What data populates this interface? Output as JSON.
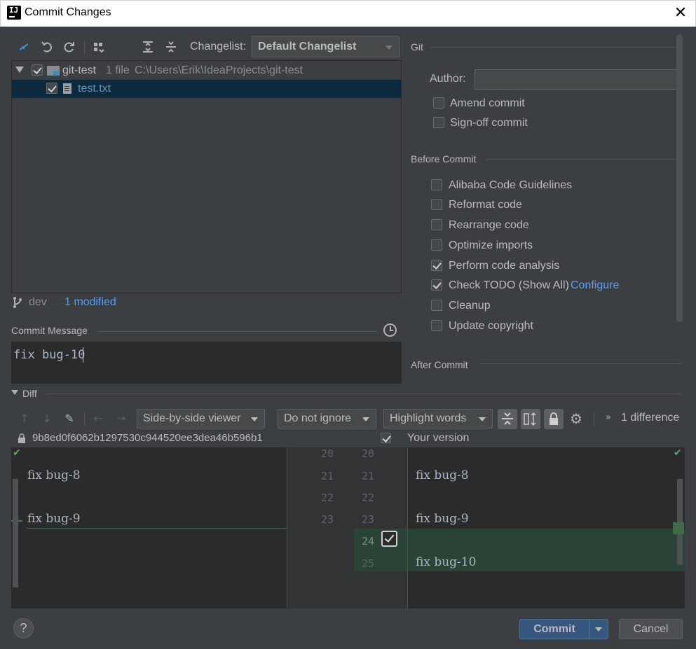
{
  "window": {
    "title": "Commit Changes",
    "close_glyph": "✕"
  },
  "toolbar": {
    "changelist_label": "Changelist:",
    "changelist_value": "Default Changelist"
  },
  "tree": {
    "root": {
      "name": "git-test",
      "count": "1 file",
      "path": "C:\\Users\\Erik\\IdeaProjects\\git-test"
    },
    "file": {
      "name": "test.txt"
    }
  },
  "status": {
    "branch": "dev",
    "modified": "1 modified"
  },
  "commit_message": {
    "label": "Commit Message",
    "value": "fix bug-10"
  },
  "git": {
    "section": "Git",
    "author_label": "Author:",
    "author_value": "",
    "amend": "Amend commit",
    "signoff": "Sign-off commit"
  },
  "before_commit": {
    "section": "Before Commit",
    "items": [
      {
        "label": "Alibaba Code Guidelines",
        "checked": false
      },
      {
        "label": "Reformat code",
        "checked": false
      },
      {
        "label": "Rearrange code",
        "checked": false
      },
      {
        "label": "Optimize imports",
        "checked": false
      },
      {
        "label": "Perform code analysis",
        "checked": true
      },
      {
        "label": "Check TODO (Show All)",
        "checked": true,
        "link": "Configure"
      },
      {
        "label": "Cleanup",
        "checked": false
      },
      {
        "label": "Update copyright",
        "checked": false
      }
    ]
  },
  "after_commit": {
    "section": "After Commit"
  },
  "diff": {
    "section": "Diff",
    "viewer": "Side-by-side viewer",
    "ignore": "Do not ignore",
    "highlight": "Highlight words",
    "difference_count": "1 difference",
    "left_revision": "9b8ed0f6062b1297530c944520ee3dea46b596b1",
    "right_revision": "Your version",
    "left_lines": [
      {
        "n": "20",
        "text": ""
      },
      {
        "n": "21",
        "text": "fix bug-8"
      },
      {
        "n": "22",
        "text": ""
      },
      {
        "n": "23",
        "text": "fix bug-9"
      }
    ],
    "right_lines": [
      {
        "n": "20",
        "text": ""
      },
      {
        "n": "21",
        "text": "fix bug-8"
      },
      {
        "n": "22",
        "text": ""
      },
      {
        "n": "23",
        "text": "fix bug-9"
      },
      {
        "n": "24",
        "text": ""
      },
      {
        "n": "25",
        "text": "fix bug-10"
      }
    ]
  },
  "buttons": {
    "help": "?",
    "commit": "Commit",
    "cancel": "Cancel"
  },
  "colors": {
    "accent": "#4a88c7",
    "added": "#294436",
    "link": "#589df6",
    "primary_button": "#365880"
  }
}
